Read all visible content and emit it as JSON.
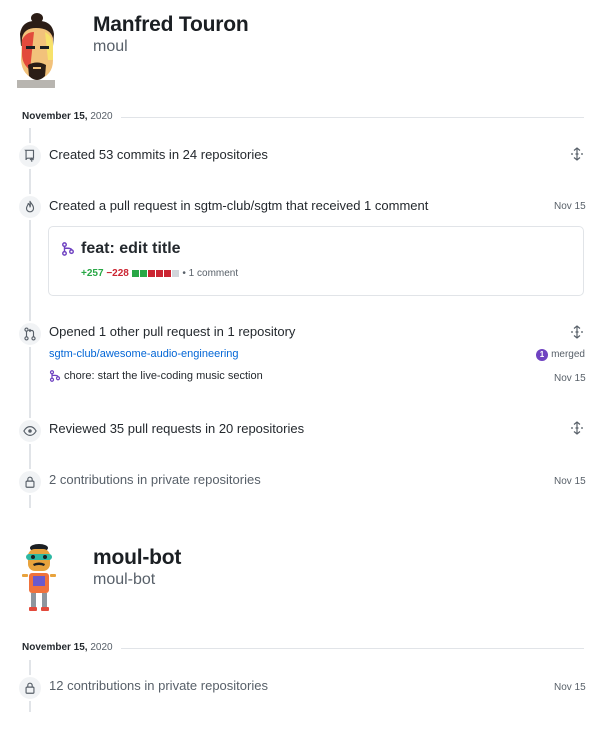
{
  "colors": {
    "additions": "#28a745",
    "deletions": "#cb2431",
    "merged": "#6f42c1",
    "link": "#0366d6",
    "neutral": "#d1d5da"
  },
  "users": [
    {
      "name": "Manfred Touron",
      "login": "moul",
      "date": {
        "day": "November 15,",
        "year": "2020"
      },
      "events": {
        "commits": {
          "icon": "repo-push-icon",
          "text": "Created 53 commits in 24 repositories"
        },
        "pr_created": {
          "icon": "flame-icon",
          "text": "Created a pull request in sgtm-club/sgtm that received 1 comment",
          "time": "Nov 15",
          "card": {
            "icon": "git-pull-request-icon",
            "title": "feat: edit title",
            "additions": "+257",
            "deletions": "−228",
            "diff_blocks": [
              "add",
              "add",
              "del",
              "del",
              "del",
              "neutral"
            ],
            "comments": "• 1 comment"
          }
        },
        "pr_opened": {
          "icon": "git-pull-request-icon",
          "text": "Opened 1 other pull request in 1 repository",
          "repo": "sgtm-club/awesome-audio-engineering",
          "merged_count": "1",
          "merged_label": "merged",
          "pr_title": "chore: start the live-coding music section",
          "time": "Nov 15"
        },
        "reviewed": {
          "icon": "eye-icon",
          "text": "Reviewed 35 pull requests in 20 repositories"
        },
        "private": {
          "icon": "lock-icon",
          "text": "2 contributions in private repositories",
          "time": "Nov 15"
        }
      }
    },
    {
      "name": "moul-bot",
      "login": "moul-bot",
      "date": {
        "day": "November 15,",
        "year": "2020"
      },
      "events": {
        "private": {
          "icon": "lock-icon",
          "text": "12 contributions in private repositories",
          "time": "Nov 15"
        }
      }
    }
  ]
}
